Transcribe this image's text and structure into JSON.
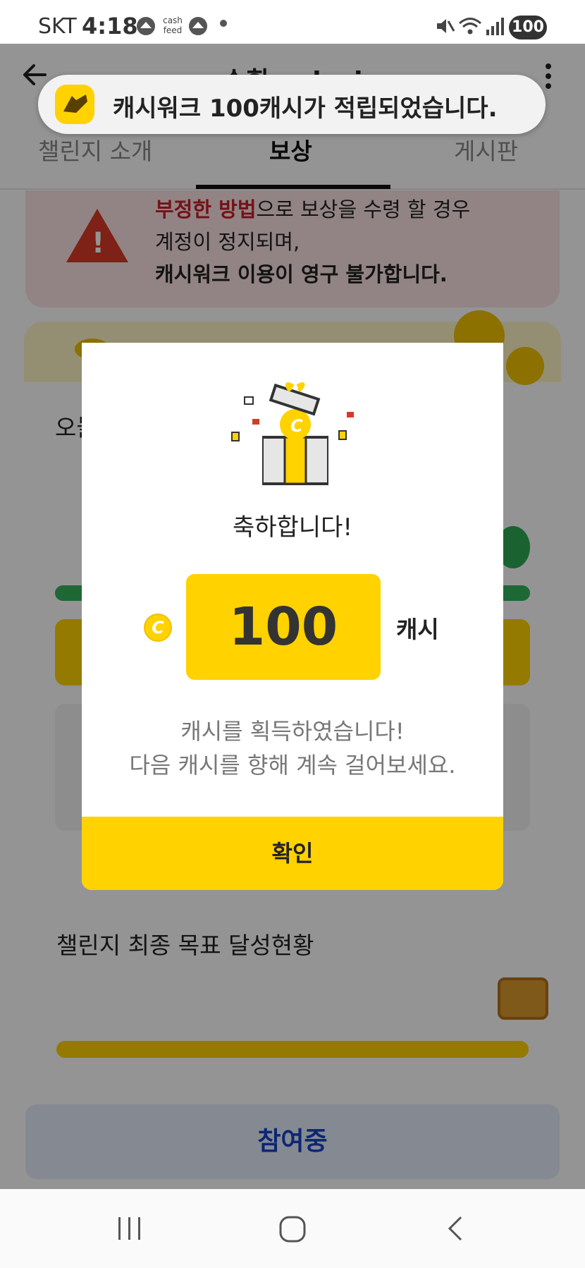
{
  "status_bar": {
    "carrier": "SKT",
    "time": "4:18",
    "app_icon_2": "cash feed",
    "battery": "100"
  },
  "header": {
    "title": "수휘 aohwi",
    "tabs": [
      {
        "label": "챌린지 소개",
        "active": false
      },
      {
        "label": "보상",
        "active": true
      },
      {
        "label": "게시판",
        "active": false
      }
    ]
  },
  "toast": {
    "text": "캐시워크 100캐시가 적립되었습니다."
  },
  "warning": {
    "line1_highlight": "부정한 방법",
    "line1_rest": "으로 보상을 수령 할 경우",
    "line2": "계정이 정지되며,",
    "line3": "캐시워크 이용이 영구 불가합니다."
  },
  "card": {
    "label_partial": "오늘"
  },
  "goal_card": {
    "title": "챌린지 최종 목표 달성현황"
  },
  "bottom": {
    "join_label": "참여중"
  },
  "modal": {
    "congrats": "축하합니다!",
    "coin_symbol": "C",
    "amount": "100",
    "unit": "캐시",
    "desc_line1": "캐시를 획득하였습니다!",
    "desc_line2": "다음 캐시를 향해 계속 걸어보세요.",
    "confirm_label": "확인"
  },
  "colors": {
    "brand_yellow": "#ffd200",
    "warning_red": "#c8202c",
    "join_blue": "#1743c9",
    "progress_green": "#34b35c"
  },
  "icons": [
    "back-arrow-icon",
    "more-vert-icon",
    "warning-triangle-icon",
    "gift-box-icon",
    "coin-icon",
    "treasure-chest-icon",
    "nav-recents-icon",
    "nav-home-icon",
    "nav-back-icon"
  ]
}
